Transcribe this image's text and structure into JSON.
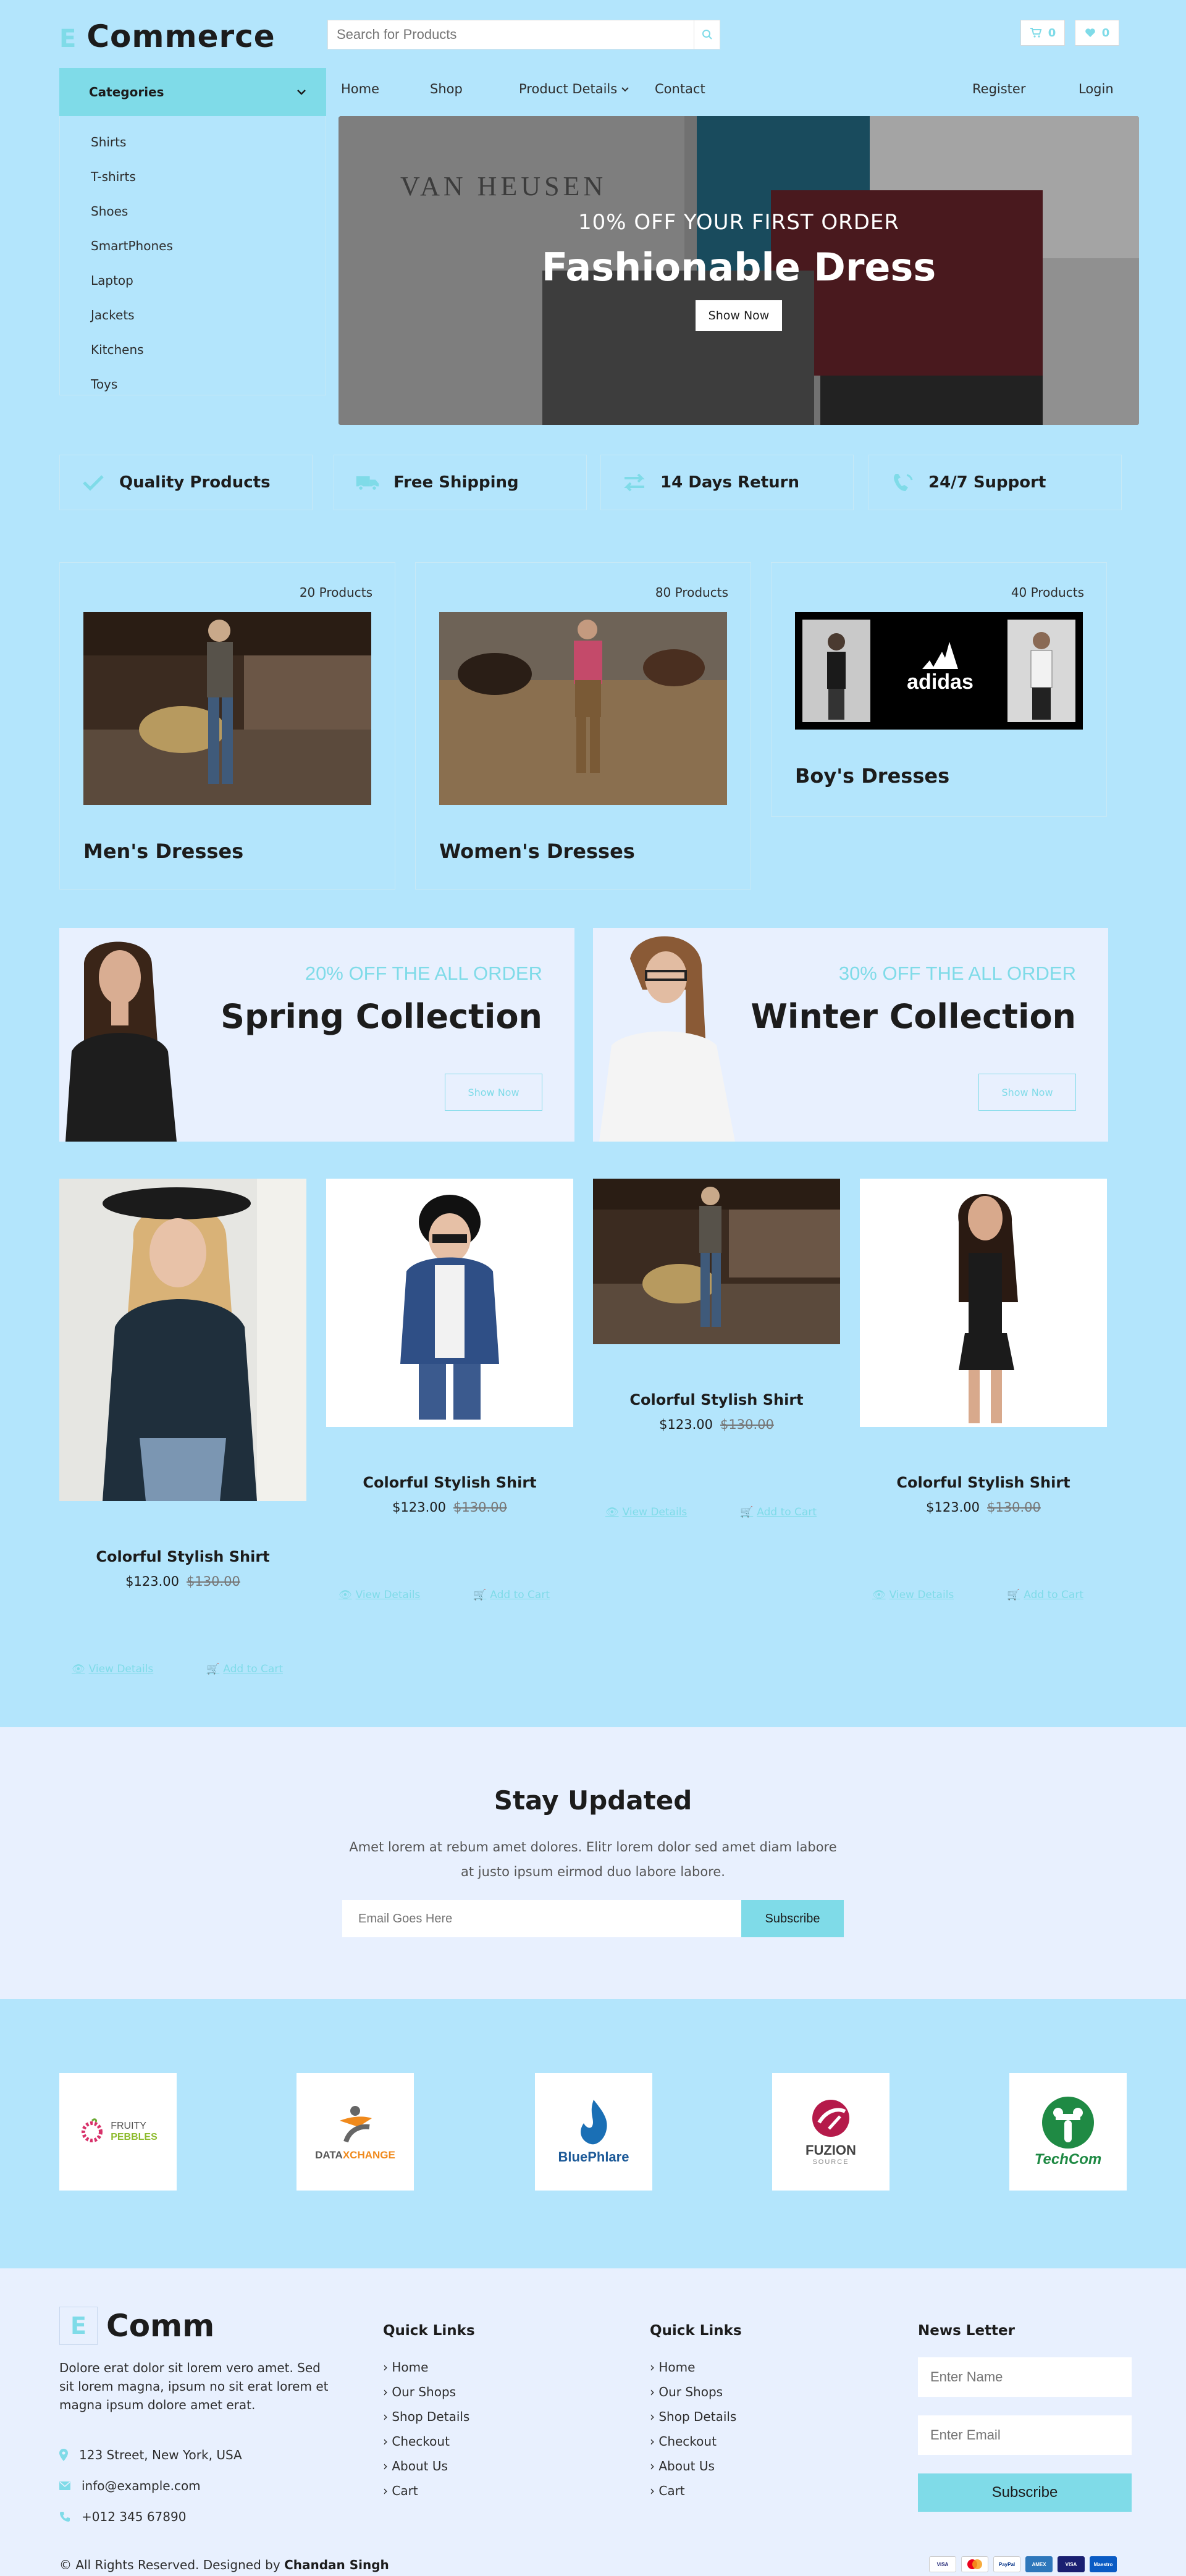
{
  "header": {
    "logo_e": "E",
    "logo_text": "Commerce",
    "search_placeholder": "Search for Products",
    "cart_count": "0",
    "wishlist_count": "0"
  },
  "categories": {
    "title": "Categories",
    "items": [
      "Shirts",
      "T-shirts",
      "Shoes",
      "SmartPhones",
      "Laptop",
      "Jackets",
      "Kitchens",
      "Toys"
    ]
  },
  "nav": {
    "home": "Home",
    "shop": "Shop",
    "product_details": "Product Details",
    "contact": "Contact",
    "register": "Register",
    "login": "Login"
  },
  "hero": {
    "brand": "VAN HEUSEN",
    "offer": "10% OFF YOUR FIRST ORDER",
    "title": "Fashionable Dress",
    "button": "Show Now"
  },
  "features": [
    {
      "label": "Quality Products",
      "icon": "check-icon"
    },
    {
      "label": "Free Shipping",
      "icon": "truck-icon"
    },
    {
      "label": "14 Days Return",
      "icon": "exchange-icon"
    },
    {
      "label": "24/7 Support",
      "icon": "phone-icon"
    }
  ],
  "category_cards": [
    {
      "count": "20 Products",
      "title": "Men's Dresses"
    },
    {
      "count": "80 Products",
      "title": "Women's Dresses"
    },
    {
      "count": "40 Products",
      "title": "Boy's Dresses",
      "logo_text": "adidas"
    }
  ],
  "offers": [
    {
      "tag": "20% OFF THE ALL ORDER",
      "title": "Spring Collection",
      "button": "Show Now"
    },
    {
      "tag": "30% OFF THE ALL ORDER",
      "title": "Winter Collection",
      "button": "Show Now"
    }
  ],
  "products": [
    {
      "name": "Colorful Stylish Shirt",
      "price": "$123.00",
      "old_price": "$130.00",
      "view": "View Details",
      "cart": "Add to Cart"
    },
    {
      "name": "Colorful Stylish Shirt",
      "price": "$123.00",
      "old_price": "$130.00",
      "view": "View Details",
      "cart": "Add to Cart"
    },
    {
      "name": "Colorful Stylish Shirt",
      "price": "$123.00",
      "old_price": "$130.00",
      "view": "View Details",
      "cart": "Add to Cart"
    },
    {
      "name": "Colorful Stylish Shirt",
      "price": "$123.00",
      "old_price": "$130.00",
      "view": "View Details",
      "cart": "Add to Cart"
    }
  ],
  "newsletter": {
    "title": "Stay Updated",
    "text": "Amet lorem at rebum amet dolores. Elitr lorem dolor sed amet diam labore at justo ipsum eirmod duo labore labore.",
    "placeholder": "Email Goes Here",
    "button": "Subscribe"
  },
  "brands": [
    {
      "name": "FRUITY PEBBLES",
      "line1": "FRUITY",
      "line2": "PEBBLES"
    },
    {
      "name": "DATAXCHANGE",
      "line1": "DATA",
      "line2": "XCHANGE"
    },
    {
      "name": "BluePhlare",
      "line1": "BluePhlare"
    },
    {
      "name": "FUZION SOURCE",
      "line1": "FUZION",
      "line2": "SOURCE"
    },
    {
      "name": "TechCom",
      "line1": "TechCom"
    }
  ],
  "footer": {
    "logo_e": "E",
    "logo_text": "Comm",
    "description": "Dolore erat dolor sit lorem vero amet. Sed sit lorem magna, ipsum no sit erat lorem et magna ipsum dolore amet erat.",
    "address": "123 Street, New York, USA",
    "email": "info@example.com",
    "phone": "+012 345 67890",
    "quick_links_1": {
      "title": "Quick Links",
      "links": [
        "Home",
        "Our Shops",
        "Shop Details",
        "Checkout",
        "About Us",
        "Cart"
      ]
    },
    "quick_links_2": {
      "title": "Quick Links",
      "links": [
        "Home",
        "Our Shops",
        "Shop Details",
        "Checkout",
        "About Us",
        "Cart"
      ]
    },
    "newsletter": {
      "title": "News Letter",
      "name_placeholder": "Enter Name",
      "email_placeholder": "Enter Email",
      "button": "Subscribe"
    },
    "copyright": "© All Rights Reserved. Designed by",
    "designer": "Chandan Singh",
    "payments": [
      "VISA",
      "MC",
      "PayPal",
      "AMEX",
      "VISA",
      "Maestro"
    ]
  },
  "colors": {
    "page_bg": "#b3e5fc",
    "accent": "#7fdbe8",
    "panel_bg": "#e8f0fe"
  }
}
